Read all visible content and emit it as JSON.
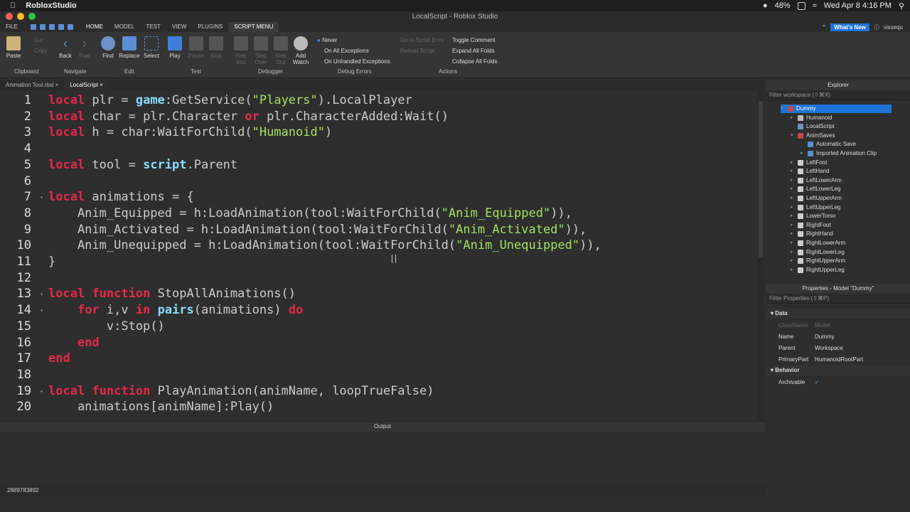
{
  "macbar": {
    "app": "RobloxStudio",
    "battery": "48%",
    "datetime": "Wed Apr 8  4:16 PM"
  },
  "window": {
    "title": "LocalScript - Roblox Studio"
  },
  "menu": {
    "tabs": [
      "FILE",
      "HOME",
      "MODEL",
      "TEST",
      "VIEW",
      "PLUGINS",
      "SCRIPT MENU"
    ],
    "whats_new": "What's New",
    "user": "vissequ"
  },
  "ribbon": {
    "paste": "Paste",
    "cut": "Cut",
    "copy": "Copy",
    "back": "Back",
    "fwd": "Fwd",
    "find": "Find",
    "replace": "Replace",
    "select": "Select",
    "play": "Play",
    "pause": "Pause",
    "stop": "Stop",
    "step_into_1": "Step",
    "step_into_2": "Into",
    "step_over_1": "Step",
    "step_over_2": "Over",
    "step_out_1": "Step",
    "step_out_2": "Out",
    "add_watch_1": "Add",
    "add_watch_2": "Watch",
    "never": "Never",
    "on_all": "On All Exceptions",
    "on_unhandled": "On Unhandled Exceptions",
    "goto_error": "Go to Script Error",
    "reload": "Reload Script",
    "toggle_comment": "Toggle Comment",
    "expand_folds": "Expand All Folds",
    "collapse_folds": "Collapse All Folds",
    "groups": {
      "clipboard": "Clipboard",
      "navigate": "Navigate",
      "edit": "Edit",
      "test": "Test",
      "debugger": "Debugger",
      "debug_errors": "Debug Errors",
      "actions": "Actions"
    }
  },
  "file_tabs": [
    "Animation Tool.rbxl",
    "LocalScript"
  ],
  "code_lines": [
    {
      "n": "1"
    },
    {
      "n": "2"
    },
    {
      "n": "3"
    },
    {
      "n": "4"
    },
    {
      "n": "5"
    },
    {
      "n": "6"
    },
    {
      "n": "7"
    },
    {
      "n": "8"
    },
    {
      "n": "9"
    },
    {
      "n": "10"
    },
    {
      "n": "11"
    },
    {
      "n": "12"
    },
    {
      "n": "13"
    },
    {
      "n": "14"
    },
    {
      "n": "15"
    },
    {
      "n": "16"
    },
    {
      "n": "17"
    },
    {
      "n": "18"
    },
    {
      "n": "19"
    },
    {
      "n": "20"
    }
  ],
  "code": {
    "l1": [
      "local",
      " plr = ",
      "game",
      ":GetService(",
      "\"Players\"",
      ").LocalPlayer"
    ],
    "l2": [
      "local",
      " char = plr.Character ",
      "or",
      " plr.CharacterAdded:Wait()"
    ],
    "l3": [
      "local",
      " h = char:WaitForChild(",
      "\"Humanoid\"",
      ")"
    ],
    "l5": [
      "local",
      " tool = ",
      "script",
      ".Parent"
    ],
    "l7": [
      "local",
      " animations = {"
    ],
    "l8": [
      "    Anim_Equipped = h:LoadAnimation(tool:WaitForChild(",
      "\"Anim_Equipped\"",
      ")),"
    ],
    "l9": [
      "    Anim_Activated = h:LoadAnimation(tool:WaitForChild(",
      "\"Anim_Activated\"",
      ")),"
    ],
    "l10": [
      "    Anim_Unequipped = h:LoadAnimation(tool:WaitForChild(",
      "\"Anim_Unequipped\"",
      ")),"
    ],
    "l11": [
      "}"
    ],
    "l13": [
      "local",
      " ",
      "function",
      " StopAllAnimations()"
    ],
    "l14": [
      "    ",
      "for",
      " i,v ",
      "in",
      " ",
      "pairs",
      "(animations) ",
      "do"
    ],
    "l15": [
      "        v:Stop()"
    ],
    "l16": [
      "    ",
      "end"
    ],
    "l17": [
      "end"
    ],
    "l19": [
      "local",
      " ",
      "function",
      " PlayAnimation(animName, loopTrueFalse)"
    ],
    "l20": [
      "    animations[animName]:Play()"
    ]
  },
  "output": {
    "title": "Output"
  },
  "cmdbar": {
    "text": "2889783892"
  },
  "explorer": {
    "title": "Explorer",
    "filter": "Filter workspace (⇧⌘X)",
    "items": [
      "Dummy",
      "Humanoid",
      "LocalScript",
      "AnimSaves",
      "Automatic Save",
      "Imported Animation Clip",
      "LeftFoot",
      "LeftHand",
      "LeftLowerArm",
      "LeftLowerLeg",
      "LeftUpperArm",
      "LeftUpperLeg",
      "LowerTorso",
      "RightFoot",
      "RightHand",
      "RightLowerArm",
      "RightLowerLeg",
      "RightUpperArm",
      "RightUpperLeg"
    ]
  },
  "properties": {
    "title": "Properties - Model \"Dummy\"",
    "filter": "Filter Properties (⇧⌘P)",
    "cat_data": "Data",
    "cat_behavior": "Behavior",
    "rows": [
      {
        "k": "ClassName",
        "v": "Model"
      },
      {
        "k": "Name",
        "v": "Dummy"
      },
      {
        "k": "Parent",
        "v": "Workspace"
      },
      {
        "k": "PrimaryPart",
        "v": "HumanoidRootPart"
      }
    ],
    "archivable": "Archivable",
    "archivable_value": "✓"
  },
  "colors": {
    "accent": "#1f74d9",
    "keyword": "#e5284a",
    "string": "#a5e05f",
    "builtin": "#8cdcfe"
  }
}
